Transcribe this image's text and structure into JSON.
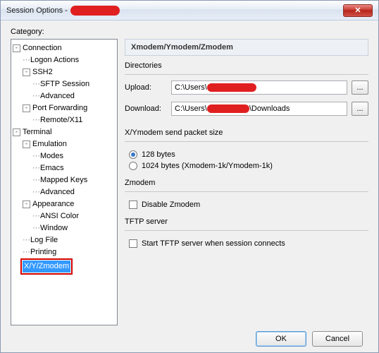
{
  "window": {
    "title": "Session Options -"
  },
  "category_label": "Category:",
  "tree": {
    "connection": "Connection",
    "logon_actions": "Logon Actions",
    "ssh2": "SSH2",
    "sftp_session": "SFTP Session",
    "advanced": "Advanced",
    "port_forwarding": "Port Forwarding",
    "remote_x11": "Remote/X11",
    "terminal": "Terminal",
    "emulation": "Emulation",
    "modes": "Modes",
    "emacs": "Emacs",
    "mapped_keys": "Mapped Keys",
    "advanced2": "Advanced",
    "appearance": "Appearance",
    "ansi_color": "ANSI Color",
    "window_item": "Window",
    "log_file": "Log File",
    "printing": "Printing",
    "xyz": "X/Y/Zmodem"
  },
  "panel": {
    "heading": "Xmodem/Ymodem/Zmodem",
    "directories": "Directories",
    "upload_label": "Upload:",
    "upload_value": "C:\\Users\\",
    "download_label": "Download:",
    "download_value_pre": "C:\\Users\\",
    "download_value_post": "\\Downloads",
    "browse": "...",
    "packet_title": "X/Ymodem send packet size",
    "packet_128": "128 bytes",
    "packet_1024": "1024 bytes  (Xmodem-1k/Ymodem-1k)",
    "zmodem_title": "Zmodem",
    "disable_zmodem": "Disable Zmodem",
    "tftp_title": "TFTP server",
    "tftp_start": "Start TFTP server when session connects"
  },
  "buttons": {
    "ok": "OK",
    "cancel": "Cancel"
  }
}
